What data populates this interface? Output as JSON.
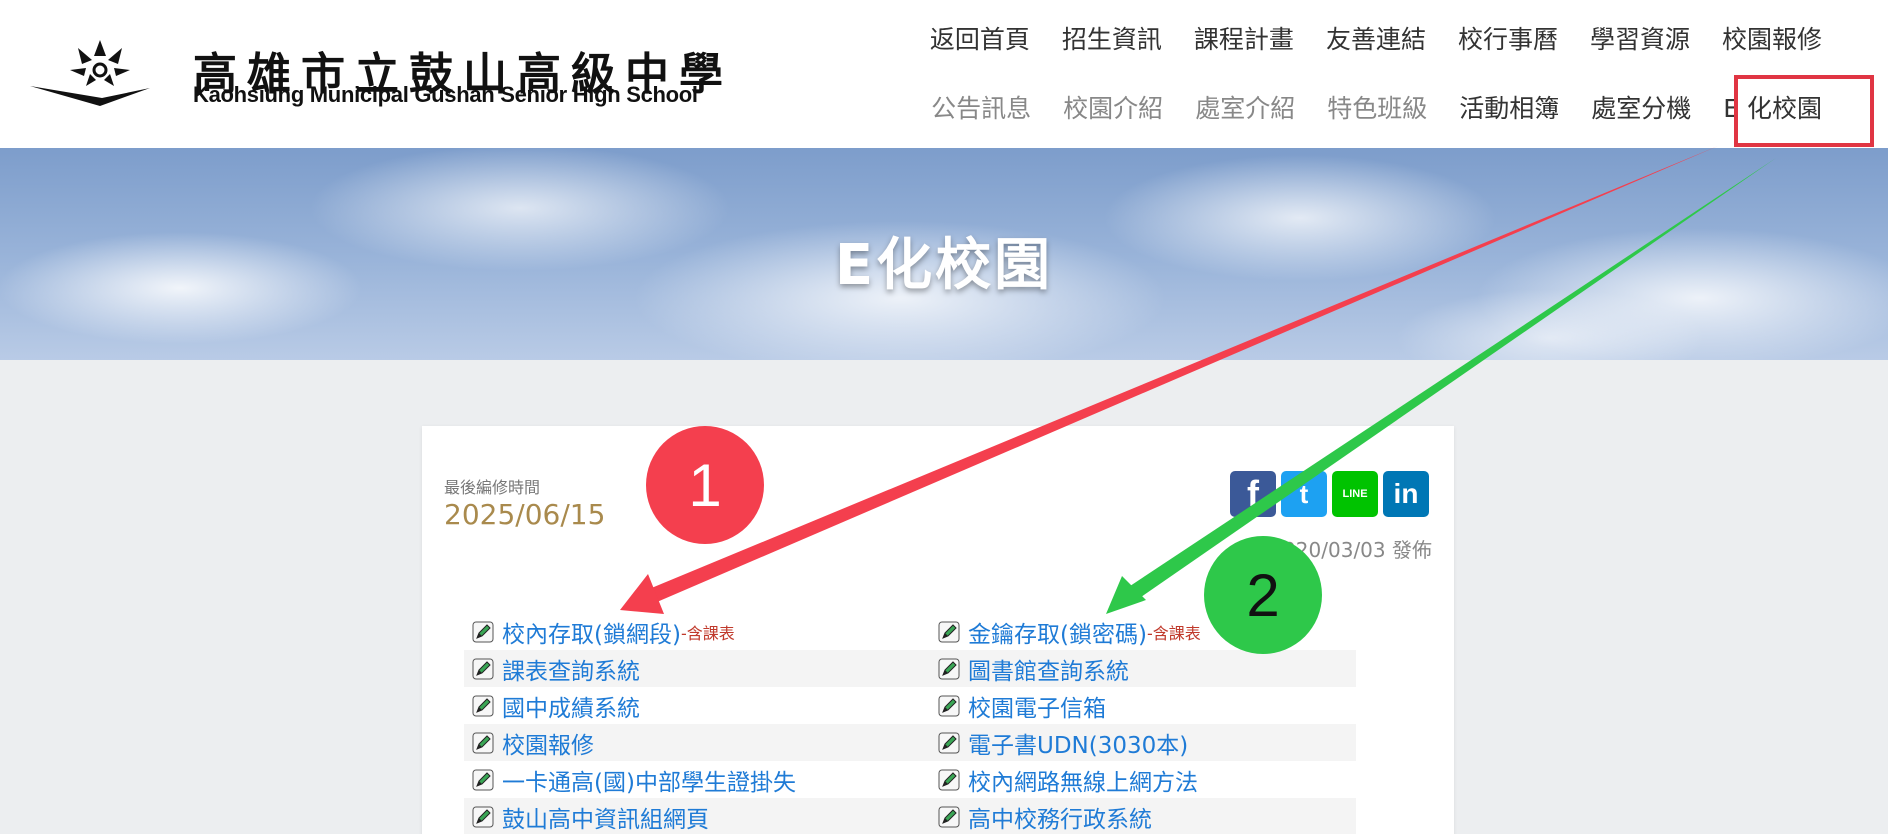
{
  "header": {
    "logo_zh": "高雄市立鼓山高級中學",
    "logo_en": "Kaohsiung Municipal Gushan Senior High School",
    "nav_top": [
      "返回首頁",
      "招生資訊",
      "課程計畫",
      "友善連結",
      "校行事曆",
      "學習資源",
      "校園報修"
    ],
    "nav_bottom": [
      "公告訊息",
      "校園介紹",
      "處室介紹",
      "特色班級",
      "活動相簿",
      "處室分機",
      "E 化校園"
    ]
  },
  "banner": {
    "title": "E化校園"
  },
  "card": {
    "edit_label": "最後編修時間",
    "edit_date": "2025/06/15",
    "published": "2020/03/03 發佈",
    "social": {
      "facebook": "f",
      "twitter": "t",
      "line": "LINE",
      "linkedin": "in"
    }
  },
  "links": {
    "left": [
      {
        "text": "校內存取(鎖網段)",
        "note": "-含課表"
      },
      {
        "text": "課表查詢系統",
        "note": ""
      },
      {
        "text": "國中成績系統",
        "note": ""
      },
      {
        "text": "校園報修",
        "note": ""
      },
      {
        "text": "一卡通高(國)中部學生證掛失",
        "note": ""
      },
      {
        "text": "鼓山高中資訊組網頁",
        "note": ""
      }
    ],
    "right": [
      {
        "text": "金鑰存取(鎖密碼)",
        "note": "-含課表"
      },
      {
        "text": "圖書館查詢系統",
        "note": ""
      },
      {
        "text": "校園電子信箱",
        "note": ""
      },
      {
        "text": "電子書UDN(3030本)",
        "note": ""
      },
      {
        "text": "校內網路無線上網方法",
        "note": ""
      },
      {
        "text": "高中校務行政系統",
        "note": ""
      }
    ]
  },
  "annotations": {
    "badge_1": "1",
    "badge_2": "2"
  },
  "colors": {
    "link": "#1f7bd6",
    "highlight": "#e03543",
    "arrow_red": "#f43f4e",
    "arrow_green": "#2ec84a",
    "date": "#a98a4d"
  }
}
